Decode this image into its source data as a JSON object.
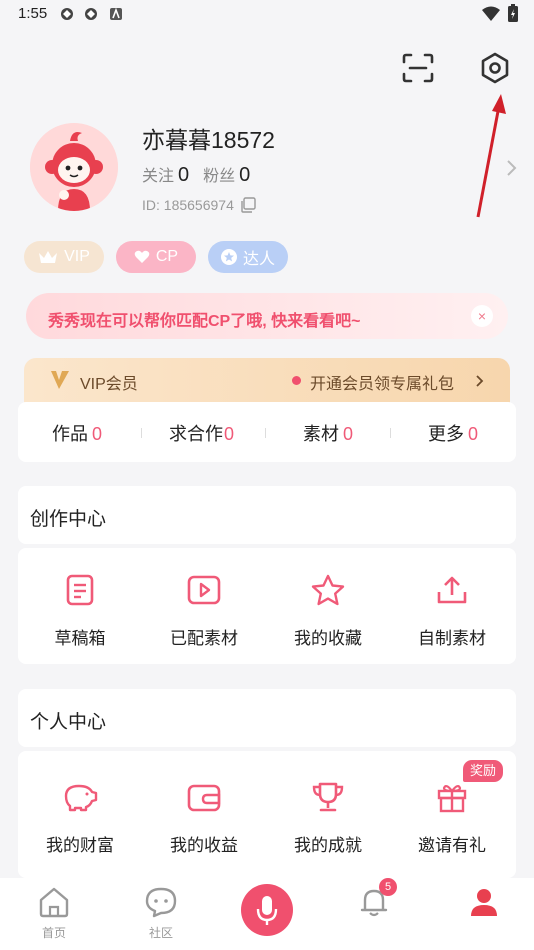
{
  "status": {
    "time": "1:55"
  },
  "profile": {
    "name": "亦暮暮18572",
    "follow_label": "关注",
    "follow_count": "0",
    "fans_label": "粉丝",
    "fans_count": "0",
    "id_text": "ID: 185656974"
  },
  "badges": [
    {
      "label": "VIP",
      "icon": "crown-icon"
    },
    {
      "label": "CP",
      "icon": "heart-icon"
    },
    {
      "label": "达人",
      "icon": "star-icon"
    }
  ],
  "banner": {
    "text": "秀秀现在可以帮你匹配CP了哦, 快来看看吧~",
    "close": "×"
  },
  "vip_bar": {
    "left": "VIP会员",
    "right": "开通会员领专属礼包"
  },
  "tabs": [
    {
      "label": "作品",
      "count": "0"
    },
    {
      "label": "求合作",
      "count": "0"
    },
    {
      "label": "素材",
      "count": "0"
    },
    {
      "label": "更多",
      "count": "0"
    }
  ],
  "creation": {
    "title": "创作中心",
    "items": [
      {
        "label": "草稿箱",
        "icon": "draft-icon"
      },
      {
        "label": "已配素材",
        "icon": "play-icon"
      },
      {
        "label": "我的收藏",
        "icon": "star-outline-icon"
      },
      {
        "label": "自制素材",
        "icon": "upload-icon"
      }
    ]
  },
  "personal": {
    "title": "个人中心",
    "items": [
      {
        "label": "我的财富",
        "icon": "piggy-bank-icon"
      },
      {
        "label": "我的收益",
        "icon": "wallet-icon"
      },
      {
        "label": "我的成就",
        "icon": "trophy-icon"
      },
      {
        "label": "邀请有礼",
        "icon": "gift-icon",
        "tag": "奖励"
      }
    ]
  },
  "nav": {
    "home": "首页",
    "community": "社区",
    "message_badge": "5"
  },
  "colors": {
    "accent": "#f05a78",
    "background": "#f5f5f7"
  }
}
